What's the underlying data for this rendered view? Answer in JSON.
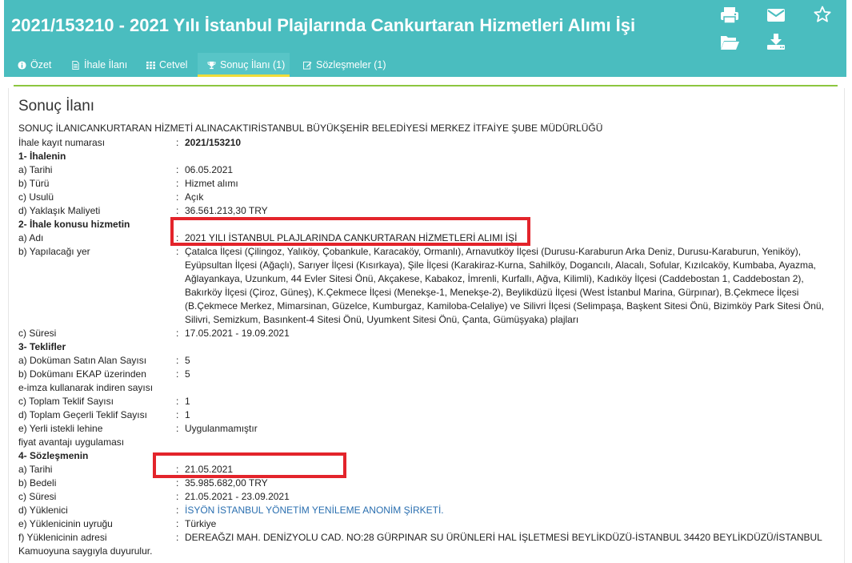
{
  "header": {
    "title": "2021/153210 - 2021 Yılı İstanbul Plajlarında Cankurtaran Hizmetleri Alımı İşi",
    "icons": [
      "print-icon",
      "mail-icon",
      "star-icon",
      "folder-open-icon",
      "download-icon"
    ]
  },
  "tabs": [
    {
      "label": "Özet",
      "icon": "info-icon"
    },
    {
      "label": "İhale İlanı",
      "icon": "document-icon"
    },
    {
      "label": "Cetvel",
      "icon": "grid-icon"
    },
    {
      "label": "Sonuç İlanı (1)",
      "icon": "trophy-icon"
    },
    {
      "label": "Sözleşmeler (1)",
      "icon": "edit-icon"
    }
  ],
  "content": {
    "section_title": "Sonuç İlanı",
    "heading": "SONUÇ İLANICANKURTARAN HİZMETİ ALINACAKTIRİSTANBUL BÜYÜKŞEHİR BELEDİYESİ MERKEZ İTFAİYE ŞUBE MÜDÜRLÜĞÜ",
    "kayit_label": "İhale kayıt numarası",
    "kayit_value": "2021/153210",
    "s1_title": "1- İhalenin",
    "s1_tarih_label": "a) Tarihi",
    "s1_tarih_value": "06.05.2021",
    "s1_turu_label": "b) Türü",
    "s1_turu_value": "Hizmet alımı",
    "s1_usulu_label": "c) Usulü",
    "s1_usulu_value": "Açık",
    "s1_maliyet_label": "d) Yaklaşık Maliyeti",
    "s1_maliyet_value": "36.561.213,30 TRY",
    "s2_title": "2- İhale konusu hizmetin",
    "s2_adi_label": "a) Adı",
    "s2_adi_value": "2021 YILI İSTANBUL PLAJLARINDA CANKURTARAN HİZMETLERİ ALIMI İŞİ",
    "s2_yer_label": "b) Yapılacağı yer",
    "s2_yer_value": "Çatalca İlçesi (Çilingoz, Yalıköy, Çobankule, Karacaköy, Ormanlı), Arnavutköy İlçesi (Durusu-Karaburun Arka Deniz, Durusu-Karaburun, Yeniköy), Eyüpsultan İlçesi (Ağaçlı), Sarıyer İlçesi (Kısırkaya), Şile İlçesi (Karakiraz-Kurna, Sahilköy, Dogancılı, Alacalı, Sofular, Kızılcaköy, Kumbaba, Ayazma, Ağlayankaya, Uzunkum, 44 Evler Sitesi Önü, Akçakese, Kabakoz, İmrenli, Kurfallı, Ağva, Kilimli), Kadıköy İlçesi (Caddebostan 1, Caddebostan 2), Bakırköy İlçesi (Çiroz, Güneş), K.Çekmece İlçesi (Menekşe-1, Menekşe-2), Beylikdüzü İlçesi (West İstanbul Marina, Gürpınar), B.Çekmece İlçesi (B.Çekmece Merkez, Mimarsinan, Güzelce, Kumburgaz, Kamiloba-Celaliye) ve Silivri İlçesi (Selimpaşa, Başkent Sitesi Önü, Bizimköy Park Sitesi Önü, Silivri, Semizkum, Basınkent-4 Sitesi Önü, Uyumkent Sitesi Önü, Çanta, Gümüşyaka) plajları",
    "s2_suresi_label": "c) Süresi",
    "s2_suresi_value": "17.05.2021 - 19.09.2021",
    "s3_title": "3- Teklifler",
    "s3_a_label": "a) Doküman Satın Alan Sayısı",
    "s3_a_value": "5",
    "s3_b_label1": "b) Dokümanı EKAP üzerinden",
    "s3_b_label2": "e-imza kullanarak indiren sayısı",
    "s3_b_value": "5",
    "s3_c_label": "c) Toplam Teklif Sayısı",
    "s3_c_value": "1",
    "s3_d_label": "d) Toplam Geçerli Teklif Sayısı",
    "s3_d_value": "1",
    "s3_e_label1": "e) Yerli istekli lehine",
    "s3_e_label2": "fiyat avantajı uygulaması",
    "s3_e_value": "Uygulanmamıştır",
    "s4_title": "4- Sözleşmenin",
    "s4_tarih_label": "a) Tarihi",
    "s4_tarih_value": "21.05.2021",
    "s4_bedel_label": "b) Bedeli",
    "s4_bedel_value": "35.985.682,00 TRY",
    "s4_suresi_label": "c) Süresi",
    "s4_suresi_value": "21.05.2021 - 23.09.2021",
    "s4_yuklenici_label": "d) Yüklenici",
    "s4_yuklenici_value": "İSYÖN İSTANBUL YÖNETİM YENİLEME ANONİM ŞİRKETİ.",
    "s4_uyruk_label": "e) Yüklenicinin uyruğu",
    "s4_uyruk_value": "Türkiye",
    "s4_adres_label": "f) Yüklenicinin adresi",
    "s4_adres_value": "DEREAĞZI MAH. DENİZYOLU CAD. NO:28 GÜRPINAR SU ÜRÜNLERİ HAL İŞLETMESİ BEYLİKDÜZÜ-İSTANBUL 34420 BEYLİKDÜZÜ/İSTANBUL",
    "closing": "Kamuoyuna saygıyla duyurulur.",
    "colon": ":"
  },
  "colors": {
    "header_bg": "#4abdbf",
    "active_tab_underline": "#f0dc3a",
    "divider": "#8cc63f",
    "highlight_box": "#e3242b",
    "link": "#2a6fb0"
  }
}
